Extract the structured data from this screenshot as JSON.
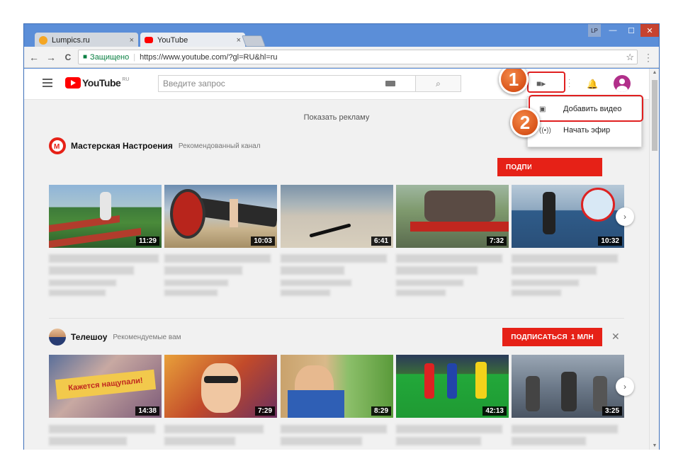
{
  "browser": {
    "tabs": [
      {
        "title": "Lumpics.ru",
        "close": "×"
      },
      {
        "title": "YouTube",
        "close": "×"
      }
    ],
    "profile_badge": "LP",
    "window_controls": {
      "minimize": "—",
      "maximize": "☐",
      "close": "✕"
    },
    "nav": {
      "back": "←",
      "forward": "→",
      "reload": "C"
    },
    "address": {
      "secure_label": "Защищено",
      "separator": "|",
      "url": "https://www.youtube.com/?gl=RU&hl=ru"
    }
  },
  "youtube": {
    "logo_text": "YouTube",
    "logo_region": "RU",
    "search_placeholder": "Введите запрос",
    "upload_menu": {
      "items": [
        {
          "icon": "upload-video-icon",
          "label": "Добавить видео"
        },
        {
          "icon": "live-icon",
          "label": "Начать эфир"
        }
      ]
    },
    "ad_text": "Показать рекламу",
    "shelves": [
      {
        "channel": "Мастерская Настроения",
        "subtitle": "Рекомендованный канал",
        "subscribe_label": "ПОДПИ",
        "videos": [
          {
            "duration": "11:29"
          },
          {
            "duration": "10:03"
          },
          {
            "duration": "6:41"
          },
          {
            "duration": "7:32"
          },
          {
            "duration": "10:32"
          }
        ]
      },
      {
        "channel": "Телешоу",
        "subtitle": "Рекомендуемые вам",
        "subscribe_label": "ПОДПИСАТЬСЯ",
        "subscribers": "1 МЛН",
        "videos": [
          {
            "duration": "14:38",
            "overlay_text": "Кажется нащупали!"
          },
          {
            "duration": "7:29"
          },
          {
            "duration": "8:29"
          },
          {
            "duration": "42:13"
          },
          {
            "duration": "3:25"
          }
        ]
      }
    ]
  },
  "annotations": [
    "1",
    "2"
  ],
  "colors": {
    "accent": "#e62117",
    "annotation": "#d9541a",
    "window": "#5c8fd9"
  }
}
